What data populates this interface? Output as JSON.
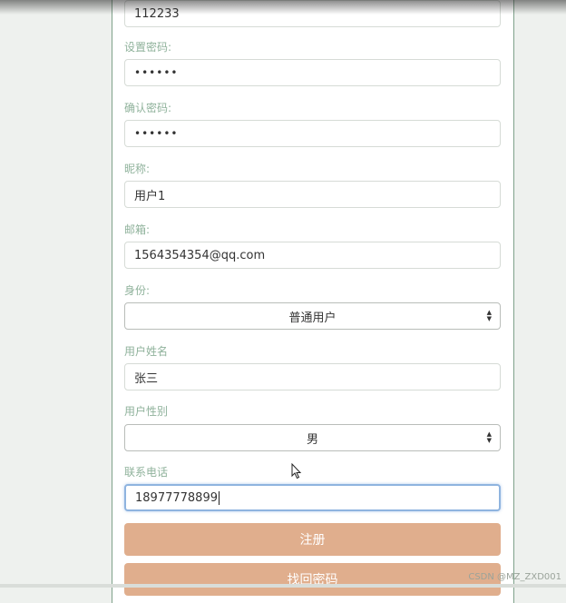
{
  "form": {
    "account_value": "112233",
    "password_label": "设置密码:",
    "password_value": "••••••",
    "confirm_label": "确认密码:",
    "confirm_value": "••••••",
    "nickname_label": "昵称:",
    "nickname_value": "用户1",
    "email_label": "邮箱:",
    "email_value": "1564354354@qq.com",
    "role_label": "身份:",
    "role_value": "普通用户",
    "realname_label": "用户姓名",
    "realname_value": "张三",
    "gender_label": "用户性别",
    "gender_value": "男",
    "phone_label": "联系电话",
    "phone_value": "18977778899"
  },
  "buttons": {
    "register_label": "注册",
    "recover_label": "找回密码"
  },
  "watermark": "CSDN @MZ_ZXD001",
  "colors": {
    "label": "#8fb29b",
    "button": "#e0ae8d",
    "focus": "#8fb4df"
  }
}
